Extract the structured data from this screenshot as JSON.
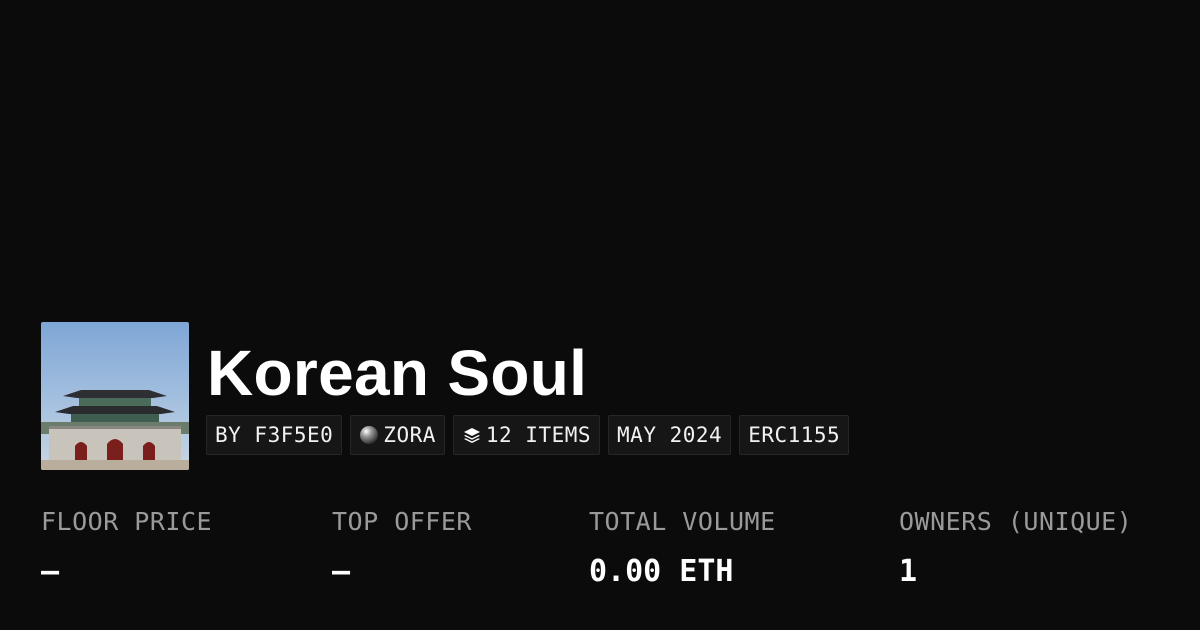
{
  "collection": {
    "title": "Korean Soul",
    "thumbnail_icon": "palace-gate-image"
  },
  "chips": {
    "creator": "BY F3F5E0",
    "network": "ZORA",
    "network_icon": "zora-orb-icon",
    "items": "12 ITEMS",
    "items_icon": "layers-icon",
    "date": "MAY 2024",
    "standard": "ERC1155"
  },
  "stats": {
    "floor_price": {
      "label": "FLOOR PRICE",
      "value": "–"
    },
    "top_offer": {
      "label": "TOP OFFER",
      "value": "–"
    },
    "total_volume": {
      "label": "TOTAL VOLUME",
      "value": "0.00 ETH"
    },
    "owners": {
      "label": "OWNERS (UNIQUE)",
      "value": "1"
    }
  },
  "colors": {
    "background": "#0b0b0b",
    "chip_background": "#161616",
    "label_gray": "#9a9a9a",
    "text": "#ffffff"
  }
}
